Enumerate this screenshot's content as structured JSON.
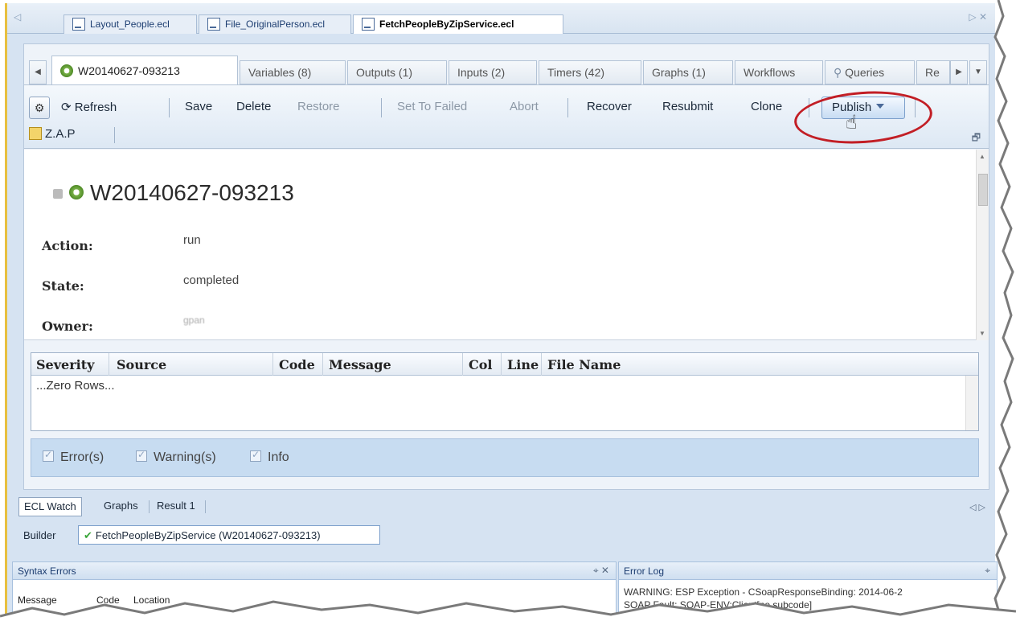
{
  "file_tabs": [
    {
      "label": "Layout_People.ecl",
      "active": false
    },
    {
      "label": "File_OriginalPerson.ecl",
      "active": false
    },
    {
      "label": "FetchPeopleByZipService.ecl",
      "active": true
    }
  ],
  "workunit_tabs": [
    {
      "label": "W20140627-093213",
      "active": true
    },
    {
      "label": "Variables (8)"
    },
    {
      "label": "Outputs (1)"
    },
    {
      "label": "Inputs (2)"
    },
    {
      "label": "Timers (42)"
    },
    {
      "label": "Graphs (1)"
    },
    {
      "label": "Workflows"
    },
    {
      "label": "Queries"
    },
    {
      "label": "Re"
    }
  ],
  "toolbar": {
    "refresh": "Refresh",
    "save": "Save",
    "delete": "Delete",
    "restore": "Restore",
    "set_to_failed": "Set To Failed",
    "abort": "Abort",
    "recover": "Recover",
    "resubmit": "Resubmit",
    "clone": "Clone",
    "publish": "Publish",
    "zap": "Z.A.P"
  },
  "details": {
    "wuid": "W20140627-093213",
    "fields": [
      {
        "label": "Action:",
        "value": "run"
      },
      {
        "label": "State:",
        "value": "completed"
      },
      {
        "label": "Owner:",
        "value": "gpan"
      }
    ]
  },
  "grid": {
    "columns": [
      "Severity",
      "Source",
      "Code",
      "Message",
      "Col",
      "Line",
      "File Name"
    ],
    "empty_text": "...Zero Rows..."
  },
  "filters": [
    {
      "label": "Error(s)",
      "checked": true
    },
    {
      "label": "Warning(s)",
      "checked": true
    },
    {
      "label": "Info",
      "checked": true
    }
  ],
  "bottom_tabs": [
    {
      "label": "ECL Watch",
      "active": true
    },
    {
      "label": "Graphs"
    },
    {
      "label": "Result 1"
    }
  ],
  "builder": {
    "label": "Builder",
    "value": "FetchPeopleByZipService (W20140627-093213)"
  },
  "syntax_errors": {
    "title": "Syntax Errors",
    "columns": [
      "Message",
      "Code",
      "Location"
    ]
  },
  "error_log": {
    "title": "Error Log",
    "lines": [
      "WARNING:  ESP Exception - CSoapResponseBinding:  2014-06-2",
      "SOAP Fault: SOAP-ENV:Client[no subcode]"
    ]
  },
  "colors": {
    "highlight": "#c21e25",
    "panel_bg": "#d6e3f2",
    "filter_bg": "#c7dcf1"
  }
}
